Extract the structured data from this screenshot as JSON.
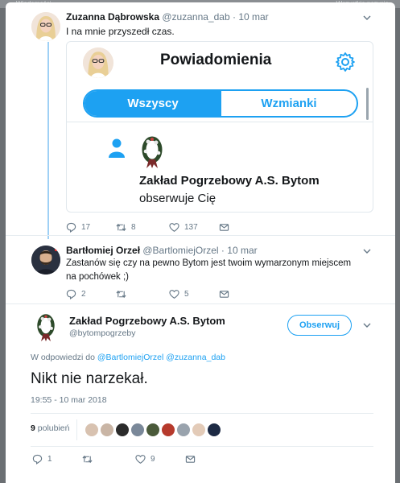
{
  "window": {
    "tab_left": "Wiadomości",
    "tab_right": "Wszystkie pozycje"
  },
  "tweet1": {
    "name": "Zuzanna Dąbrowska",
    "handle": "@zuzanna_dab",
    "date": "10 mar",
    "text": "I na mnie przyszedł czas.",
    "embed": {
      "title": "Powiadomienia",
      "tab_all": "Wszyscy",
      "tab_mentions": "Wzmianki",
      "follower_name": "Zakład Pogrzebowy A.S. Bytom",
      "follower_action": "obserwuje Cię"
    },
    "replies": "17",
    "retweets": "8",
    "likes": "137"
  },
  "tweet2": {
    "name": "Bartłomiej Orzeł",
    "handle": "@BartlomiejOrzel",
    "date": "10 mar",
    "text": "Zastanów się czy na pewno Bytom jest twoim wymarzonym miejscem na pochówek ;)",
    "replies": "2",
    "retweets": "",
    "likes": "5"
  },
  "tweet3": {
    "name": "Zakład Pogrzebowy A.S. Bytom",
    "handle": "@bytompogrzeby",
    "follow_label": "Obserwuj",
    "reply_prefix": "W odpowiedzi do",
    "reply_to_1": "@BartlomiejOrzel",
    "reply_to_2": "@zuzanna_dab",
    "text": "Nikt nie narzekał.",
    "timestamp": "19:55 - 10 mar 2018",
    "likes_count": "9",
    "likes_label": "polubień",
    "replies": "1",
    "retweets": "",
    "likes": "9"
  },
  "colors": {
    "accent": "#1da1f2",
    "thread": "#9fd0f5",
    "muted": "#657786"
  },
  "likers": [
    "#d8c2b0",
    "#c9b5a5",
    "#2b2b2b",
    "#7a8899",
    "#4a5a3a",
    "#b63a2c",
    "#99a3ad",
    "#e3cbb8",
    "#1d2a44"
  ]
}
